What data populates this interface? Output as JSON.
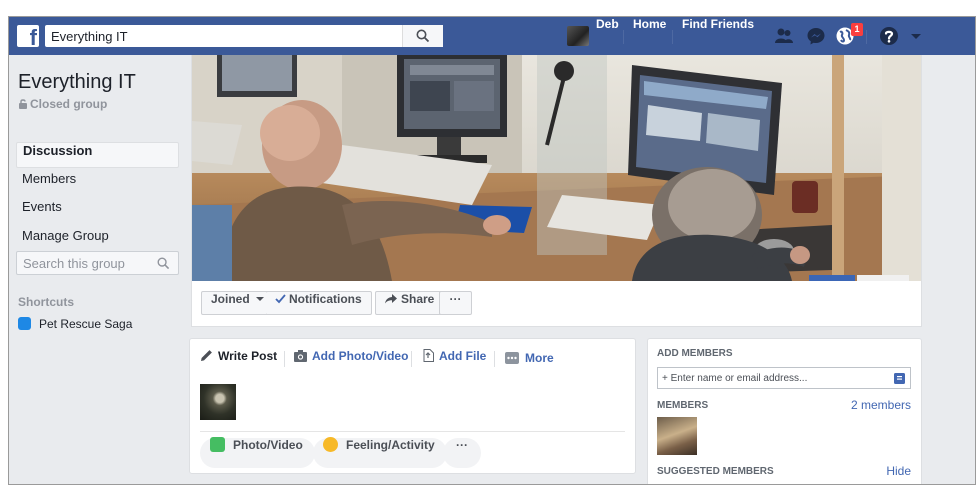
{
  "topbar": {
    "logo": "f",
    "search_value": "Everything IT",
    "user_name": "Deb",
    "home_label": "Home",
    "find_friends_label": "Find Friends",
    "notification_count": "1",
    "brand_color": "#3b5998"
  },
  "group": {
    "title": "Everything IT",
    "privacy": "Closed group"
  },
  "sidebar": {
    "items": [
      {
        "label": "Discussion"
      },
      {
        "label": "Members"
      },
      {
        "label": "Events"
      },
      {
        "label": "Manage Group"
      }
    ],
    "search_placeholder": "Search this group",
    "shortcuts_heading": "Shortcuts",
    "shortcuts": [
      {
        "label": "Pet Rescue Saga"
      }
    ]
  },
  "actions": {
    "joined_label": "Joined",
    "notifications_label": "Notifications",
    "share_label": "Share",
    "more_label": "···"
  },
  "composer": {
    "tabs": [
      {
        "label": "Write Post"
      },
      {
        "label": "Add Photo/Video"
      },
      {
        "label": "Add File"
      },
      {
        "label": "More"
      }
    ],
    "buttons": [
      {
        "label": "Photo/Video"
      },
      {
        "label": "Feeling/Activity"
      },
      {
        "label": "···"
      }
    ]
  },
  "right_panel": {
    "add_members_heading": "ADD MEMBERS",
    "add_members_placeholder": "+ Enter name or email address...",
    "members_heading": "MEMBERS",
    "members_count": "2 members",
    "suggested_heading": "SUGGESTED MEMBERS",
    "hide_label": "Hide"
  }
}
